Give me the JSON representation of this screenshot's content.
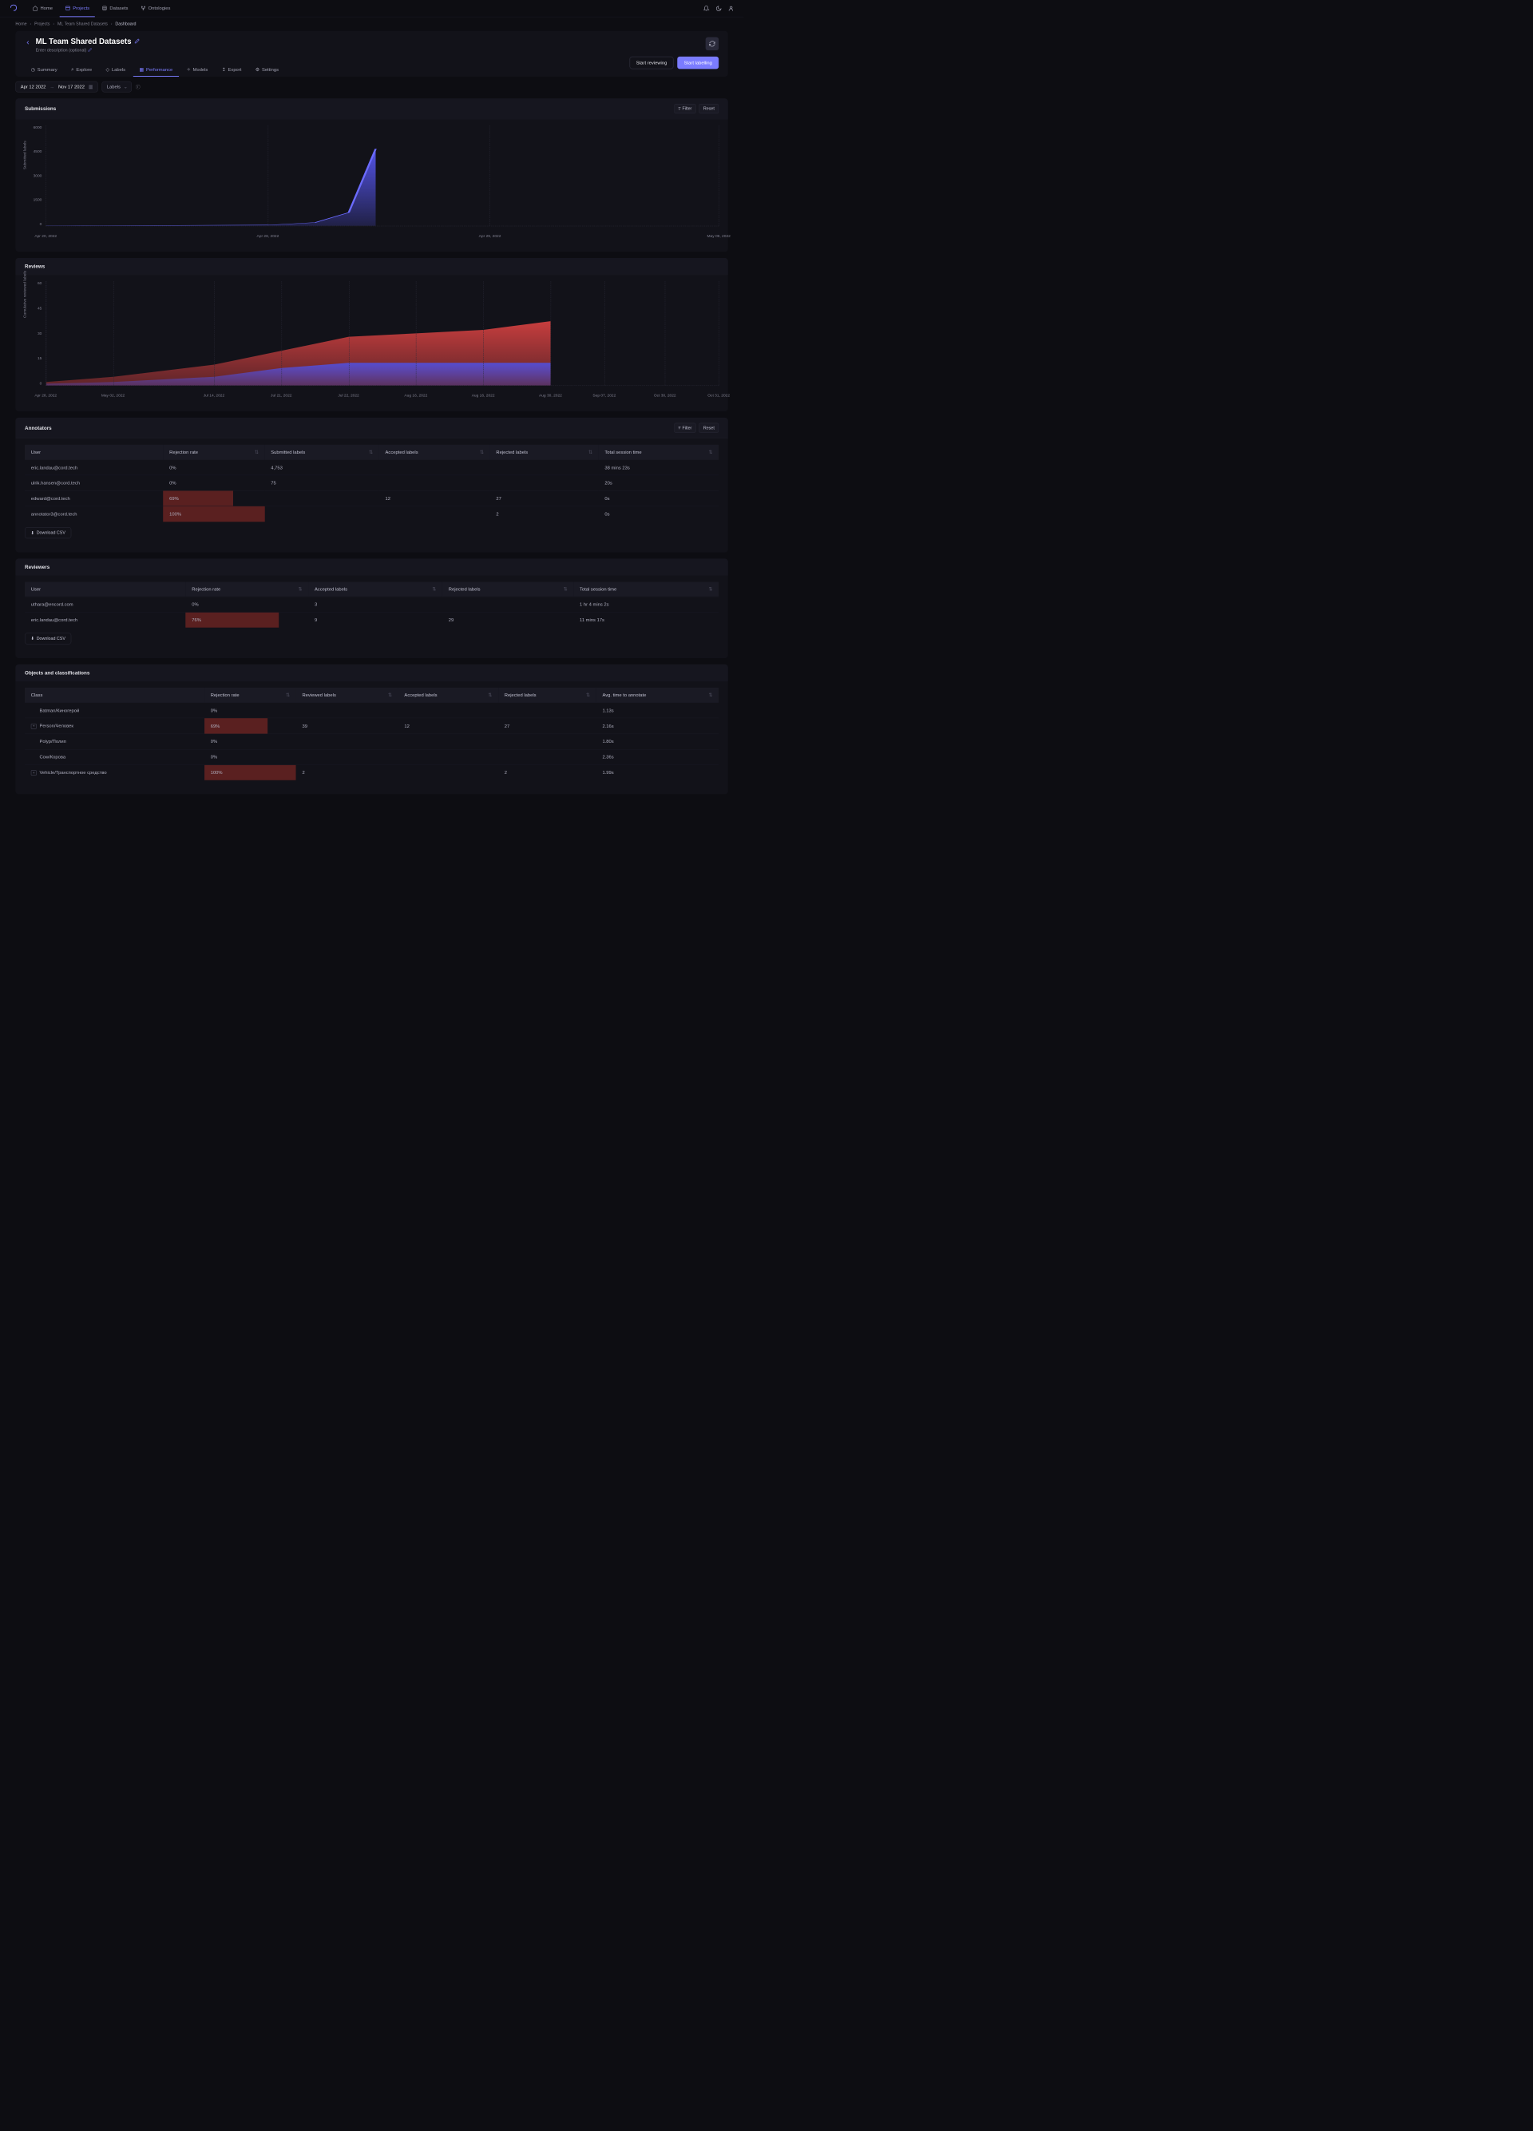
{
  "nav": {
    "items": [
      "Home",
      "Projects",
      "Datasets",
      "Ontologies"
    ]
  },
  "breadcrumb": [
    "Home",
    "Projects",
    "ML Team Shared Datasets",
    "Dashboard"
  ],
  "page": {
    "title": "ML Team Shared Datasets",
    "subtitle": "Enter description (optional)"
  },
  "tabs": [
    "Summary",
    "Explore",
    "Labels",
    "Performance",
    "Models",
    "Export",
    "Settings"
  ],
  "actions": {
    "review": "Start reviewing",
    "label": "Start labelling"
  },
  "filters": {
    "date_from": "Apr 12 2022",
    "date_to": "Nov 17 2022",
    "select": "Labels",
    "filter_btn": "Filter",
    "reset_btn": "Reset"
  },
  "chart_data": [
    {
      "type": "area",
      "title": "Submissions",
      "ylabel": "Submitted labels",
      "ylim": [
        0,
        6000
      ],
      "y_ticks": [
        6000,
        4500,
        3000,
        1500,
        0
      ],
      "x_ticks": [
        {
          "label": "Apr 20, 2022",
          "pos": 0
        },
        {
          "label": "Apr 28, 2022",
          "pos": 33
        },
        {
          "label": "Apr 29, 2022",
          "pos": 66
        },
        {
          "label": "May 09, 2022",
          "pos": 100
        }
      ],
      "series": [
        {
          "name": "submitted",
          "color": "#5b5bff",
          "points": [
            {
              "x": 0,
              "y": 0
            },
            {
              "x": 33,
              "y": 50
            },
            {
              "x": 40,
              "y": 200
            },
            {
              "x": 45,
              "y": 800
            },
            {
              "x": 49,
              "y": 4600
            }
          ]
        }
      ]
    },
    {
      "type": "area",
      "title": "Reviews",
      "ylabel": "Cumulative reviewed labels",
      "ylim": [
        0,
        60
      ],
      "y_ticks": [
        60,
        45,
        30,
        15,
        0
      ],
      "x_ticks": [
        {
          "label": "Apr 28, 2022",
          "pos": 0
        },
        {
          "label": "May 02, 2022",
          "pos": 10
        },
        {
          "label": "Jul 14, 2022",
          "pos": 25
        },
        {
          "label": "Jul 21, 2022",
          "pos": 35
        },
        {
          "label": "Jul 22, 2022",
          "pos": 45
        },
        {
          "label": "Aug 16, 2022",
          "pos": 55
        },
        {
          "label": "Aug 16, 2022",
          "pos": 65
        },
        {
          "label": "Aug 30, 2022",
          "pos": 75
        },
        {
          "label": "Sep 07, 2022",
          "pos": 83
        },
        {
          "label": "Oct 30, 2022",
          "pos": 92
        },
        {
          "label": "Oct 31, 2022",
          "pos": 100
        }
      ],
      "series": [
        {
          "name": "accepted",
          "color": "#d04040",
          "points": [
            {
              "x": 0,
              "y": 2
            },
            {
              "x": 10,
              "y": 5
            },
            {
              "x": 25,
              "y": 12
            },
            {
              "x": 35,
              "y": 20
            },
            {
              "x": 45,
              "y": 28
            },
            {
              "x": 55,
              "y": 30
            },
            {
              "x": 65,
              "y": 32
            },
            {
              "x": 75,
              "y": 37
            }
          ]
        },
        {
          "name": "rejected",
          "color": "#5050e0",
          "points": [
            {
              "x": 0,
              "y": 1
            },
            {
              "x": 10,
              "y": 2
            },
            {
              "x": 25,
              "y": 5
            },
            {
              "x": 35,
              "y": 10
            },
            {
              "x": 45,
              "y": 13
            },
            {
              "x": 55,
              "y": 13
            },
            {
              "x": 65,
              "y": 13
            },
            {
              "x": 75,
              "y": 13
            }
          ]
        }
      ]
    }
  ],
  "annotators": {
    "title": "Annotators",
    "columns": [
      "User",
      "Rejection rate",
      "Submitted labels",
      "Accepted labels",
      "Rejected labels",
      "Total session time"
    ],
    "rows": [
      {
        "user": "eric.landau@cord.tech",
        "rej": "0%",
        "rej_pct": 0,
        "submitted": "4,753",
        "accepted": "",
        "rejected": "",
        "time": "38 mins 23s"
      },
      {
        "user": "ulrik.hansen@cord.tech",
        "rej": "0%",
        "rej_pct": 0,
        "submitted": "75",
        "accepted": "",
        "rejected": "",
        "time": "20s"
      },
      {
        "user": "edward@cord.tech",
        "rej": "69%",
        "rej_pct": 69,
        "submitted": "",
        "accepted": "12",
        "rejected": "27",
        "time": "0s"
      },
      {
        "user": "annotator3@cord.tech",
        "rej": "100%",
        "rej_pct": 100,
        "submitted": "",
        "accepted": "",
        "rejected": "2",
        "time": "0s"
      }
    ],
    "download": "Download CSV"
  },
  "reviewers": {
    "title": "Reviewers",
    "columns": [
      "User",
      "Rejection rate",
      "Accepted labels",
      "Rejected labels",
      "Total session time"
    ],
    "rows": [
      {
        "user": "uthara@encord.com",
        "rej": "0%",
        "rej_pct": 0,
        "accepted": "3",
        "rejected": "",
        "time": "1 hr 4 mins 2s"
      },
      {
        "user": "eric.landau@cord.tech",
        "rej": "76%",
        "rej_pct": 76,
        "accepted": "9",
        "rejected": "29",
        "time": "11 mins 17s"
      }
    ],
    "download": "Download CSV"
  },
  "objects": {
    "title": "Objects and classifications",
    "columns": [
      "Class",
      "Rejection rate",
      "Reviewed labels",
      "Accepted labels",
      "Rejected labels",
      "Avg. time to annotate"
    ],
    "rows": [
      {
        "cls": "Batman/Киногерой",
        "expand": false,
        "rej": "0%",
        "rej_pct": 0,
        "reviewed": "",
        "accepted": "",
        "rejected": "",
        "time": "1.13s"
      },
      {
        "cls": "Person/Человек",
        "expand": true,
        "rej": "69%",
        "rej_pct": 69,
        "reviewed": "39",
        "accepted": "12",
        "rejected": "27",
        "time": "2.16s"
      },
      {
        "cls": "Polyp/Полип",
        "expand": false,
        "rej": "0%",
        "rej_pct": 0,
        "reviewed": "",
        "accepted": "",
        "rejected": "",
        "time": "1.80s"
      },
      {
        "cls": "Cow/Корова",
        "expand": false,
        "rej": "0%",
        "rej_pct": 0,
        "reviewed": "",
        "accepted": "",
        "rejected": "",
        "time": "2.36s"
      },
      {
        "cls": "Vehicle/Транспортное средство",
        "expand": true,
        "rej": "100%",
        "rej_pct": 100,
        "reviewed": "2",
        "accepted": "",
        "rejected": "2",
        "time": "1.99s"
      }
    ]
  }
}
